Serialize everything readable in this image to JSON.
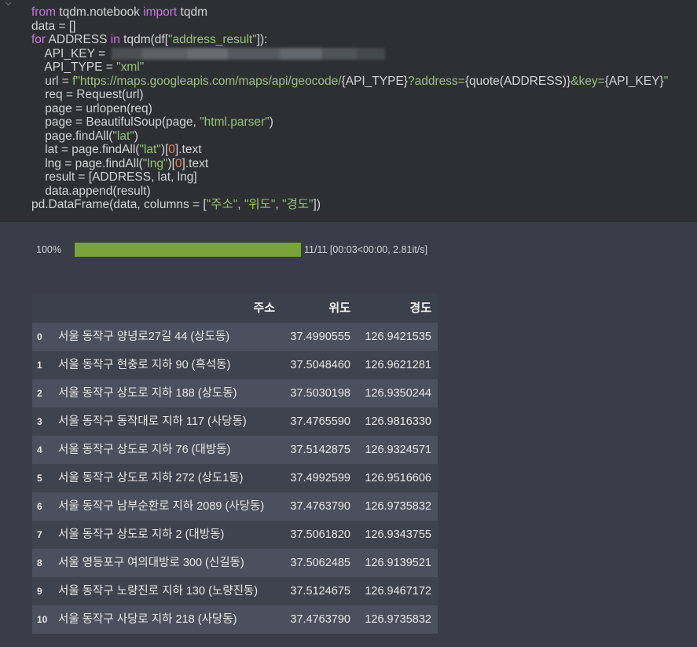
{
  "colors": {
    "code_bg": "#2d2f33",
    "output_bg": "#383d47",
    "code_text": "#d4d4d4",
    "keyword": "#c678dd",
    "string": "#98c379",
    "number": "#e5885a",
    "progress_bar": "#79a43a",
    "table_header_bg": "#3b414b",
    "table_row_even_bg": "#4a515c",
    "table_row_odd_bg": "#3e444e",
    "table_text": "#e8e8e8"
  },
  "code_cell": {
    "lines": [
      {
        "tokens": [
          {
            "v": "from",
            "color": "#c678dd"
          },
          {
            "v": " tqdm.notebook "
          },
          {
            "v": "import",
            "color": "#c678dd"
          },
          {
            "v": " tqdm"
          }
        ]
      },
      {
        "tokens": [
          {
            "v": "data = []"
          }
        ]
      },
      {
        "tokens": [
          {
            "v": "for",
            "color": "#c678dd"
          },
          {
            "v": " ADDRESS "
          },
          {
            "v": "in",
            "color": "#c678dd"
          },
          {
            "v": " tqdm(df["
          },
          {
            "v": "\"address_result\"",
            "color": "#98c379"
          },
          {
            "v": "]):"
          }
        ]
      },
      {
        "tokens": [
          {
            "v": "    API_KEY = "
          }
        ]
      },
      {
        "tokens": [
          {
            "v": "    API_TYPE = "
          },
          {
            "v": "\"xml\"",
            "color": "#98c379"
          }
        ]
      },
      {
        "tokens": [
          {
            "v": "    url = "
          },
          {
            "v": "f\"https://maps.googleapis.com/maps/api/geocode/",
            "color": "#98c379"
          },
          {
            "v": "{API_TYPE}"
          },
          {
            "v": "?address=",
            "color": "#98c379"
          },
          {
            "v": "{quote(ADDRESS)}"
          },
          {
            "v": "&key=",
            "color": "#98c379"
          },
          {
            "v": "{API_KEY}"
          },
          {
            "v": "\"",
            "color": "#98c379"
          }
        ]
      },
      {
        "tokens": [
          {
            "v": "    req = Request(url)"
          }
        ]
      },
      {
        "tokens": [
          {
            "v": "    page = urlopen(req)"
          }
        ]
      },
      {
        "tokens": [
          {
            "v": "    page = BeautifulSoup(page, "
          },
          {
            "v": "\"html.parser\"",
            "color": "#98c379"
          },
          {
            "v": ")"
          }
        ]
      },
      {
        "tokens": [
          {
            "v": "    page.findAll("
          },
          {
            "v": "\"lat\"",
            "color": "#98c379"
          },
          {
            "v": ")"
          }
        ]
      },
      {
        "tokens": [
          {
            "v": "    lat = page.findAll("
          },
          {
            "v": "\"lat\"",
            "color": "#98c379"
          },
          {
            "v": ")["
          },
          {
            "v": "0",
            "color": "#e5885a"
          },
          {
            "v": "].text"
          }
        ]
      },
      {
        "tokens": [
          {
            "v": "    lng = page.findAll("
          },
          {
            "v": "\"lng\"",
            "color": "#98c379"
          },
          {
            "v": ")["
          },
          {
            "v": "0",
            "color": "#e5885a"
          },
          {
            "v": "].text"
          }
        ]
      },
      {
        "tokens": [
          {
            "v": "    result = [ADDRESS, lat, lng]"
          }
        ]
      },
      {
        "tokens": [
          {
            "v": "    data.append(result)"
          }
        ]
      },
      {
        "tokens": [
          {
            "v": "pd.DataFrame(data, columns = ["
          },
          {
            "v": "\"주소\"",
            "color": "#98c379"
          },
          {
            "v": ", "
          },
          {
            "v": "\"위도\"",
            "color": "#98c379"
          },
          {
            "v": ", "
          },
          {
            "v": "\"경도\"",
            "color": "#98c379"
          },
          {
            "v": "])"
          }
        ]
      }
    ]
  },
  "progress": {
    "percent_label": "100%",
    "fraction": 1.0,
    "stats": "11/11 [00:03<00:00, 2.81it/s]"
  },
  "dataframe": {
    "columns": [
      "주소",
      "위도",
      "경도"
    ],
    "rows": [
      {
        "index": "0",
        "address": "서울 동작구 양녕로27길 44 (상도동)",
        "lat": "37.4990555",
        "lng": "126.9421535"
      },
      {
        "index": "1",
        "address": "서울 동작구 현충로 지하 90 (흑석동)",
        "lat": "37.5048460",
        "lng": "126.9621281"
      },
      {
        "index": "2",
        "address": "서울 동작구 상도로 지하 188 (상도동)",
        "lat": "37.5030198",
        "lng": "126.9350244"
      },
      {
        "index": "3",
        "address": "서울 동작구 동작대로 지하 117 (사당동)",
        "lat": "37.4765590",
        "lng": "126.9816330"
      },
      {
        "index": "4",
        "address": "서울 동작구 상도로 지하 76 (대방동)",
        "lat": "37.5142875",
        "lng": "126.9324571"
      },
      {
        "index": "5",
        "address": "서울 동작구 상도로 지하 272 (상도1동)",
        "lat": "37.4992599",
        "lng": "126.9516606"
      },
      {
        "index": "6",
        "address": "서울 동작구 남부순환로 지하 2089 (사당동)",
        "lat": "37.4763790",
        "lng": "126.9735832"
      },
      {
        "index": "7",
        "address": "서울 동작구 상도로 지하 2 (대방동)",
        "lat": "37.5061820",
        "lng": "126.9343755"
      },
      {
        "index": "8",
        "address": "서울 영등포구 여의대방로 300 (신길동)",
        "lat": "37.5062485",
        "lng": "126.9139521"
      },
      {
        "index": "9",
        "address": "서울 동작구 노량진로 지하 130 (노량진동)",
        "lat": "37.5124675",
        "lng": "126.9467172"
      },
      {
        "index": "10",
        "address": "서울 동작구 사당로 지하 218 (사당동)",
        "lat": "37.4763790",
        "lng": "126.9735832"
      }
    ]
  }
}
